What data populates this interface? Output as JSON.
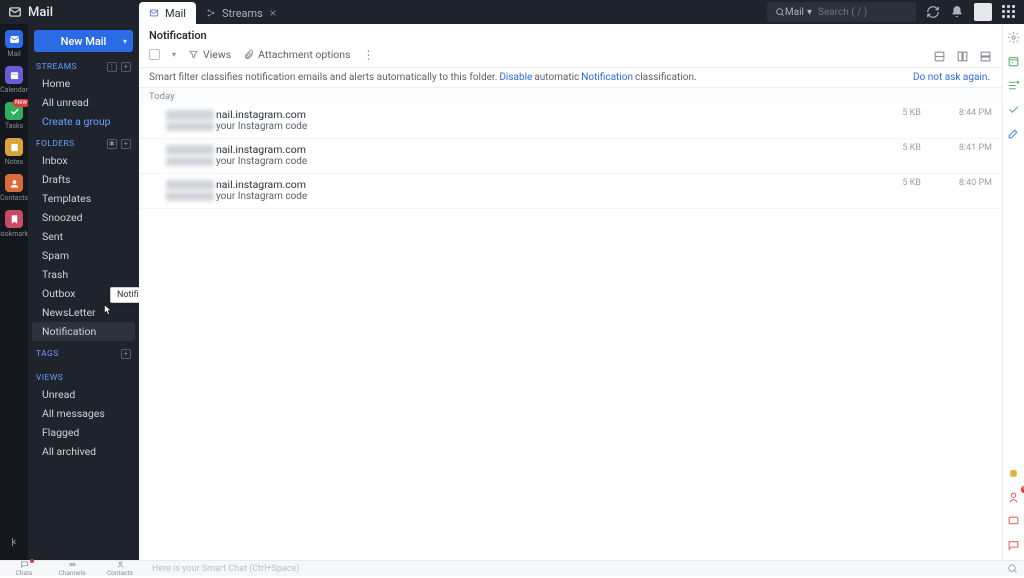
{
  "brand": "Mail",
  "tabs": [
    {
      "label": "Mail",
      "active": true,
      "closable": false
    },
    {
      "label": "Streams",
      "active": false,
      "closable": true
    }
  ],
  "search": {
    "scope": "Mail",
    "placeholder": "Search ( / )"
  },
  "rail": [
    {
      "name": "mail",
      "label": "Mail",
      "color": "#2b6be6",
      "active": true
    },
    {
      "name": "calendar",
      "label": "Calendar",
      "color": "#6a5bd6"
    },
    {
      "name": "tasks",
      "label": "Tasks",
      "color": "#2fae60",
      "badge": "New"
    },
    {
      "name": "notes",
      "label": "Notes",
      "color": "#d9a33a"
    },
    {
      "name": "contacts",
      "label": "Contacts",
      "color": "#d96a3a"
    },
    {
      "name": "bookmarks",
      "label": "Bookmarks",
      "color": "#c94a63"
    }
  ],
  "sidebar": {
    "newmail": "New Mail",
    "streams_head": "STREAMS",
    "streams": [
      {
        "label": "Home"
      },
      {
        "label": "All unread"
      },
      {
        "label": "Create a group",
        "link": true
      }
    ],
    "folders_head": "FOLDERS",
    "folders": [
      {
        "label": "Inbox"
      },
      {
        "label": "Drafts"
      },
      {
        "label": "Templates"
      },
      {
        "label": "Snoozed"
      },
      {
        "label": "Sent"
      },
      {
        "label": "Spam"
      },
      {
        "label": "Trash"
      },
      {
        "label": "Outbox"
      },
      {
        "label": "NewsLetter"
      },
      {
        "label": "Notification",
        "selected": true
      }
    ],
    "tags_head": "TAGS",
    "views_head": "VIEWS",
    "views": [
      {
        "label": "Unread"
      },
      {
        "label": "All messages"
      },
      {
        "label": "Flagged"
      },
      {
        "label": "All archived"
      }
    ],
    "tooltip": "Notification"
  },
  "page": {
    "title": "Notification",
    "views_btn": "Views",
    "attach_btn": "Attachment options",
    "smartfilter": {
      "text_a": "Smart filter classifies notification emails and alerts automatically to this folder. ",
      "disable": "Disable",
      "text_b": " automatic ",
      "notif": "Notification",
      "text_c": " classification.",
      "dont_ask": "Do not ask again."
    },
    "group": "Today",
    "messages": [
      {
        "from": "nail.instagram.com",
        "subject": "your Instagram code",
        "size": "5 KB",
        "time": "8:44 PM"
      },
      {
        "from": "nail.instagram.com",
        "subject": "your Instagram code",
        "size": "5 KB",
        "time": "8:41 PM"
      },
      {
        "from": "nail.instagram.com",
        "subject": "your Instagram code",
        "size": "5 KB",
        "time": "8:40 PM"
      }
    ]
  },
  "bottom": {
    "tabs": [
      {
        "label": "Chats",
        "dot": true
      },
      {
        "label": "Channels"
      },
      {
        "label": "Contacts"
      }
    ],
    "hint": "Here is your Smart Chat (Ctrl+Space)"
  }
}
